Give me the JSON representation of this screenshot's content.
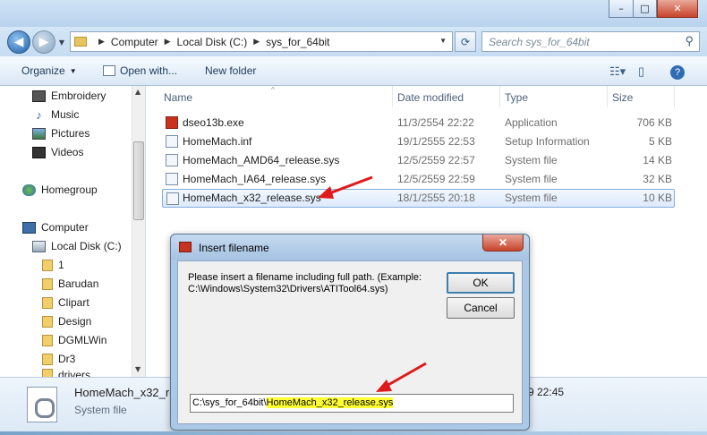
{
  "window": {
    "minimize_glyph": "–",
    "maximize_glyph": "□",
    "close_glyph": "✕"
  },
  "address": {
    "crumbs": [
      "Computer",
      "Local Disk (C:)",
      "sys_for_64bit"
    ],
    "separator": "▶",
    "dropdown_glyph": "▼",
    "refresh_glyph": "⟳"
  },
  "search": {
    "placeholder": "Search sys_for_64bit",
    "icon_glyph": "⚲"
  },
  "toolbar": {
    "organize": "Organize",
    "open_with": "Open with...",
    "new_folder": "New folder",
    "menu_arrow": "▼"
  },
  "nav": {
    "items": [
      {
        "label": "Embroidery",
        "icon": "library-icon"
      },
      {
        "label": "Music",
        "icon": "music-icon"
      },
      {
        "label": "Pictures",
        "icon": "pictures-icon"
      },
      {
        "label": "Videos",
        "icon": "videos-icon"
      },
      {
        "label": "Homegroup",
        "icon": "homegroup-icon"
      },
      {
        "label": "Computer",
        "icon": "computer-icon"
      },
      {
        "label": "Local Disk (C:)",
        "icon": "drive-icon"
      },
      {
        "label": "1",
        "icon": "folder-icon"
      },
      {
        "label": "Barudan",
        "icon": "folder-icon"
      },
      {
        "label": "Clipart",
        "icon": "folder-icon"
      },
      {
        "label": "Design",
        "icon": "folder-icon"
      },
      {
        "label": "DGMLWin",
        "icon": "folder-icon"
      },
      {
        "label": "Dr3",
        "icon": "folder-icon"
      },
      {
        "label": "drivers",
        "icon": "folder-icon"
      }
    ]
  },
  "files": {
    "columns": [
      "Name",
      "Date modified",
      "Type",
      "Size"
    ],
    "sort_glyph": "^",
    "rows": [
      {
        "name": "dseo13b.exe",
        "date": "11/3/2554 22:22",
        "type": "Application",
        "size": "706 KB",
        "icon": "exe-icon"
      },
      {
        "name": "HomeMach.inf",
        "date": "19/1/2555 22:53",
        "type": "Setup Information",
        "size": "5 KB",
        "icon": "inf-icon"
      },
      {
        "name": "HomeMach_AMD64_release.sys",
        "date": "12/5/2559 22:57",
        "type": "System file",
        "size": "14 KB",
        "icon": "sys-icon"
      },
      {
        "name": "HomeMach_IA64_release.sys",
        "date": "12/5/2559 22:59",
        "type": "System file",
        "size": "32 KB",
        "icon": "sys-icon"
      },
      {
        "name": "HomeMach_x32_release.sys",
        "date": "18/1/2555 20:18",
        "type": "System file",
        "size": "10 KB",
        "icon": "sys-icon",
        "selected": true
      }
    ]
  },
  "details": {
    "name": "HomeMach_x32_re",
    "type": "System file",
    "date_fragment": "9 22:45"
  },
  "dialog": {
    "title": "Insert filename",
    "prompt_line1": "Please insert a filename including full path. (Example:",
    "prompt_line2": "C:\\Windows\\System32\\Drivers\\ATITool64.sys)",
    "ok": "OK",
    "cancel": "Cancel",
    "close_glyph": "✕",
    "input_prefix": "C:\\sys_for_64bit\\",
    "input_highlight": "HomeMach_x32_release.sys"
  },
  "colors": {
    "annotation_arrow": "#e0191b",
    "highlight": "#ffff33"
  }
}
